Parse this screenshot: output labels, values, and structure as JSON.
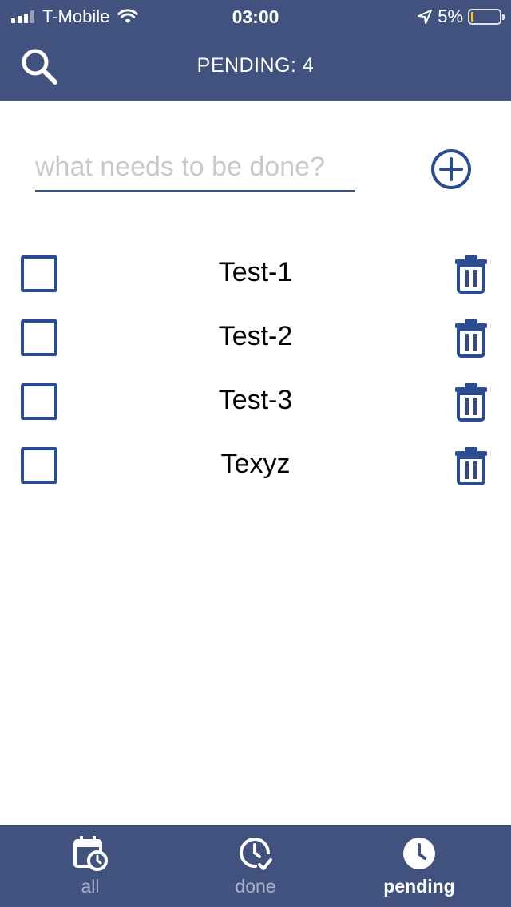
{
  "status_bar": {
    "carrier": "T-Mobile",
    "time": "03:00",
    "battery_percent": "5%",
    "battery_level": 0.05,
    "signal_bars": 3,
    "icons": [
      "signal-icon",
      "wifi-icon",
      "location-arrow-icon",
      "battery-icon"
    ]
  },
  "header": {
    "title": "PENDING: 4",
    "search_icon": "search-icon",
    "background_color": "#40527d"
  },
  "new_todo": {
    "placeholder": "what needs to be done?",
    "value": "",
    "add_icon": "plus-circle-icon"
  },
  "todos": [
    {
      "text": "Test-1",
      "done": false
    },
    {
      "text": "Test-2",
      "done": false
    },
    {
      "text": "Test-3",
      "done": false
    },
    {
      "text": "Texyz",
      "done": false
    }
  ],
  "tabs": [
    {
      "label": "all",
      "icon": "calendar-clock-icon",
      "active": false
    },
    {
      "label": "done",
      "icon": "clock-check-icon",
      "active": false
    },
    {
      "label": "pending",
      "icon": "clock-icon",
      "active": true
    }
  ],
  "colors": {
    "accent": "#2b4c91",
    "bar": "#40527d",
    "inactive_tab": "#a6b1cb"
  }
}
